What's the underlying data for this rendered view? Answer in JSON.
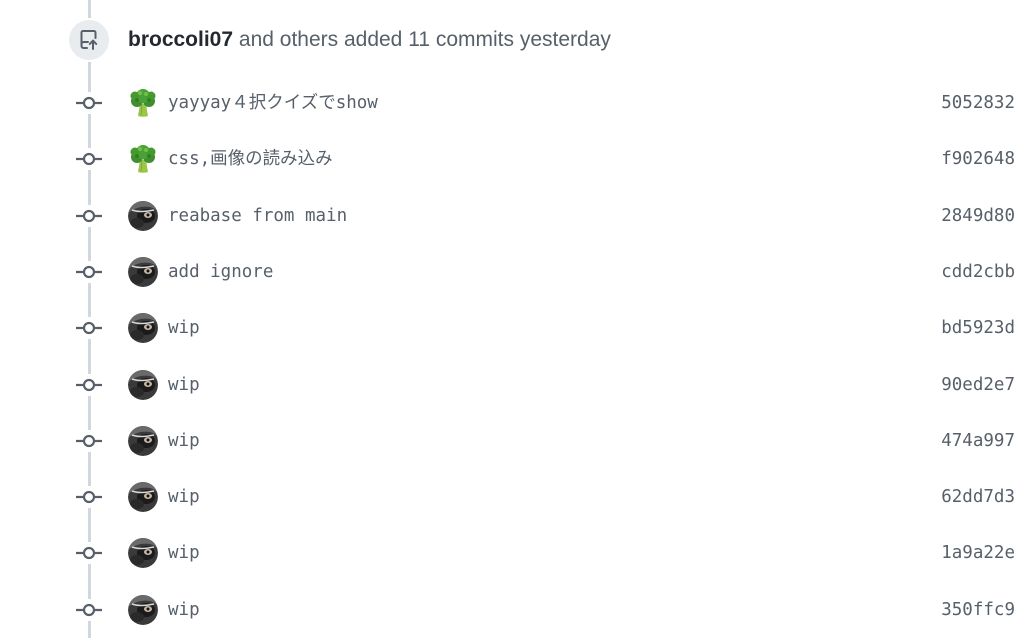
{
  "push_event": {
    "author": "broccoli07",
    "summary": "and others added 11 commits yesterday",
    "icon": "repo-push-icon"
  },
  "commits": [
    {
      "message": "yayyay４択クイズでshow",
      "sha": "5052832",
      "avatar": "broccoli"
    },
    {
      "message": "css,画像の読み込み",
      "sha": "f902648",
      "avatar": "broccoli"
    },
    {
      "message": "reabase from main",
      "sha": "2849d80",
      "avatar": "dark"
    },
    {
      "message": "add ignore",
      "sha": "cdd2cbb",
      "avatar": "dark"
    },
    {
      "message": "wip",
      "sha": "bd5923d",
      "avatar": "dark"
    },
    {
      "message": "wip",
      "sha": "90ed2e7",
      "avatar": "dark"
    },
    {
      "message": "wip",
      "sha": "474a997",
      "avatar": "dark"
    },
    {
      "message": "wip",
      "sha": "62dd7d3",
      "avatar": "dark"
    },
    {
      "message": "wip",
      "sha": "1a9a22e",
      "avatar": "dark"
    },
    {
      "message": "wip",
      "sha": "350ffc9",
      "avatar": "dark"
    }
  ],
  "colors": {
    "timeline": "#d0d7de",
    "text_muted": "#57606a",
    "text_strong": "#24292f",
    "badge_bg": "#e9ecef"
  }
}
